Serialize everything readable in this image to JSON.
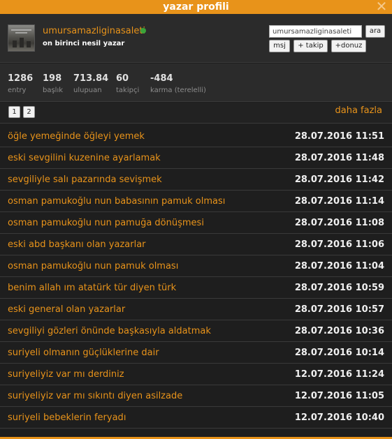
{
  "window": {
    "title": "yazar profili",
    "close_symbol": "✕"
  },
  "profile": {
    "username": "umursamazliginasaleti",
    "rank": "on birinci nesil yazar",
    "status_color": "#3aa33a"
  },
  "search": {
    "value": "umursamazliginasaleti",
    "button_label": "ara"
  },
  "actions": {
    "msj": "msj",
    "takip": "+ takip",
    "donuz": "+donuz"
  },
  "stats": [
    {
      "value": "1286",
      "label": "entry"
    },
    {
      "value": "198",
      "label": "başlık"
    },
    {
      "value": "713.84",
      "label": "ulupuan"
    },
    {
      "value": "60",
      "label": "takipçi"
    },
    {
      "value": "-484",
      "label": "karma (terelelli)"
    }
  ],
  "pagination": {
    "pages": [
      "1",
      "2"
    ],
    "more_label": "daha fazla"
  },
  "entries": [
    {
      "title": "öğle yemeğinde öğleyi yemek",
      "date": "28.07.2016 11:51"
    },
    {
      "title": "eski sevgilini kuzenine ayarlamak",
      "date": "28.07.2016 11:48"
    },
    {
      "title": "sevgiliyle salı pazarında sevişmek",
      "date": "28.07.2016 11:42"
    },
    {
      "title": "osman pamukoğlu nun babasının pamuk olması",
      "date": "28.07.2016 11:14"
    },
    {
      "title": "osman pamukoğlu nun pamuğa dönüşmesi",
      "date": "28.07.2016 11:08"
    },
    {
      "title": "eski abd başkanı olan yazarlar",
      "date": "28.07.2016 11:06"
    },
    {
      "title": "osman pamukoğlu nun pamuk olması",
      "date": "28.07.2016 11:04"
    },
    {
      "title": "benim allah ım atatürk tür diyen türk",
      "date": "28.07.2016 10:59"
    },
    {
      "title": "eski general olan yazarlar",
      "date": "28.07.2016 10:57"
    },
    {
      "title": "sevgiliyi gözleri önünde başkasıyla aldatmak",
      "date": "28.07.2016 10:36"
    },
    {
      "title": "suriyeli olmanın güçlüklerine dair",
      "date": "28.07.2016 10:14"
    },
    {
      "title": "suriyeliyiz var mı derdiniz",
      "date": "12.07.2016 11:24"
    },
    {
      "title": "suriyeliyiz var mı sıkıntı diyen asilzade",
      "date": "12.07.2016 11:05"
    },
    {
      "title": "suriyeli bebeklerin feryadı",
      "date": "12.07.2016 10:40"
    }
  ],
  "colors": {
    "accent": "#e8931a",
    "background": "#1e1e1e",
    "panel": "#2b2b2b"
  }
}
